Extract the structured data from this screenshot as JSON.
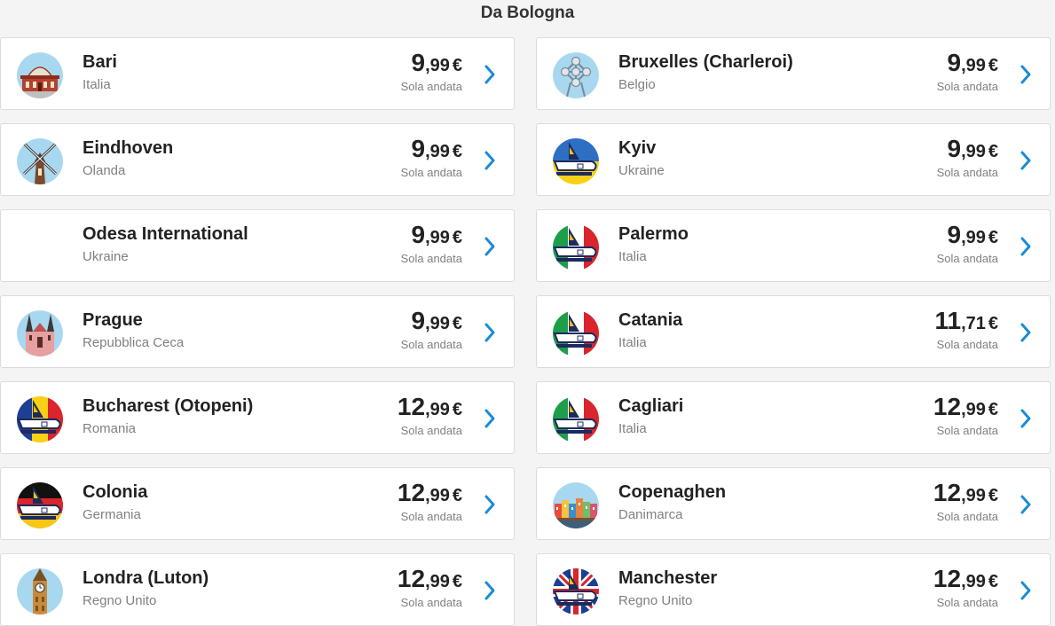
{
  "header": {
    "title": "Da Bologna"
  },
  "colors": {
    "accent": "#1a8cd8",
    "label_gray": "#808080"
  },
  "routes": [
    {
      "city": "Bari",
      "country": "Italia",
      "price_int": "9",
      "price_dec": ",99",
      "currency": "€",
      "oneway": "Sola andata",
      "icon": "basilica-icon"
    },
    {
      "city": "Bruxelles (Charleroi)",
      "country": "Belgio",
      "price_int": "9",
      "price_dec": ",99",
      "currency": "€",
      "oneway": "Sola andata",
      "icon": "atomium-icon"
    },
    {
      "city": "Eindhoven",
      "country": "Olanda",
      "price_int": "9",
      "price_dec": ",99",
      "currency": "€",
      "oneway": "Sola andata",
      "icon": "windmill-icon"
    },
    {
      "city": "Kyiv",
      "country": "Ukraine",
      "price_int": "9",
      "price_dec": ",99",
      "currency": "€",
      "oneway": "Sola andata",
      "icon": "airplane-ukraine-icon"
    },
    {
      "city": "Odesa International",
      "country": "Ukraine",
      "price_int": "9",
      "price_dec": ",99",
      "currency": "€",
      "oneway": "Sola andata",
      "icon": "none"
    },
    {
      "city": "Palermo",
      "country": "Italia",
      "price_int": "9",
      "price_dec": ",99",
      "currency": "€",
      "oneway": "Sola andata",
      "icon": "airplane-italy-icon"
    },
    {
      "city": "Prague",
      "country": "Repubblica Ceca",
      "price_int": "9",
      "price_dec": ",99",
      "currency": "€",
      "oneway": "Sola andata",
      "icon": "tyn-church-icon"
    },
    {
      "city": "Catania",
      "country": "Italia",
      "price_int": "11",
      "price_dec": ",71",
      "currency": "€",
      "oneway": "Sola andata",
      "icon": "airplane-italy-icon"
    },
    {
      "city": "Bucharest (Otopeni)",
      "country": "Romania",
      "price_int": "12",
      "price_dec": ",99",
      "currency": "€",
      "oneway": "Sola andata",
      "icon": "airplane-romania-icon"
    },
    {
      "city": "Cagliari",
      "country": "Italia",
      "price_int": "12",
      "price_dec": ",99",
      "currency": "€",
      "oneway": "Sola andata",
      "icon": "airplane-italy-icon"
    },
    {
      "city": "Colonia",
      "country": "Germania",
      "price_int": "12",
      "price_dec": ",99",
      "currency": "€",
      "oneway": "Sola andata",
      "icon": "airplane-germany-icon"
    },
    {
      "city": "Copenaghen",
      "country": "Danimarca",
      "price_int": "12",
      "price_dec": ",99",
      "currency": "€",
      "oneway": "Sola andata",
      "icon": "nyhavn-icon"
    },
    {
      "city": "Londra (Luton)",
      "country": "Regno Unito",
      "price_int": "12",
      "price_dec": ",99",
      "currency": "€",
      "oneway": "Sola andata",
      "icon": "big-ben-icon"
    },
    {
      "city": "Manchester",
      "country": "Regno Unito",
      "price_int": "12",
      "price_dec": ",99",
      "currency": "€",
      "oneway": "Sola andata",
      "icon": "airplane-uk-icon"
    }
  ]
}
